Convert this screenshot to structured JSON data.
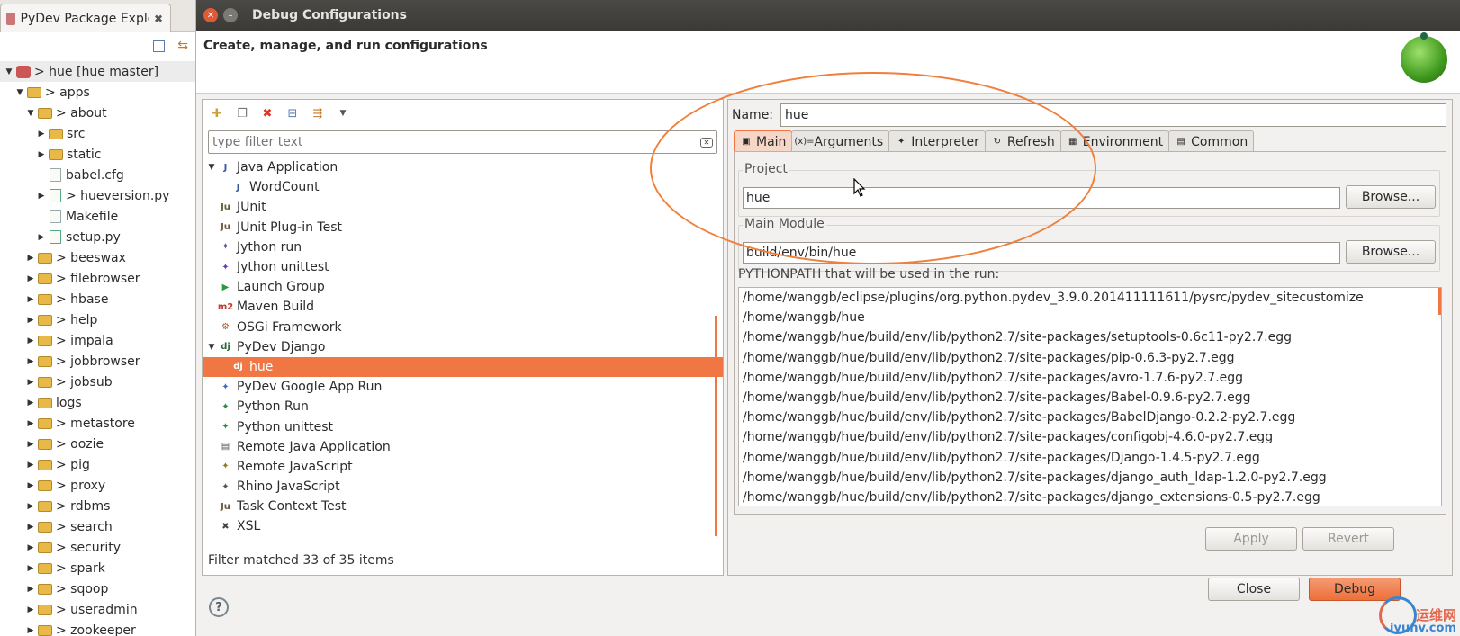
{
  "explorer": {
    "tab_title": "PyDev Package Explo",
    "close_glyph": "✖",
    "tree": [
      {
        "label": "> hue  [hue master]",
        "indent": 0,
        "kind": "project",
        "tri": "▼",
        "root": true
      },
      {
        "label": "> apps",
        "indent": 1,
        "kind": "folder",
        "tri": "▼"
      },
      {
        "label": "> about",
        "indent": 2,
        "kind": "folder",
        "tri": "▼"
      },
      {
        "label": "src",
        "indent": 3,
        "kind": "folder",
        "tri": "▶"
      },
      {
        "label": "static",
        "indent": 3,
        "kind": "folder",
        "tri": "▶"
      },
      {
        "label": "babel.cfg",
        "indent": 3,
        "kind": "file",
        "tri": ""
      },
      {
        "label": "> hueversion.py",
        "indent": 3,
        "kind": "py",
        "tri": "▶"
      },
      {
        "label": "Makefile",
        "indent": 3,
        "kind": "file",
        "tri": ""
      },
      {
        "label": "setup.py",
        "indent": 3,
        "kind": "py",
        "tri": "▶"
      },
      {
        "label": "> beeswax",
        "indent": 2,
        "kind": "folder",
        "tri": "▶"
      },
      {
        "label": "> filebrowser",
        "indent": 2,
        "kind": "folder",
        "tri": "▶"
      },
      {
        "label": "> hbase",
        "indent": 2,
        "kind": "folder",
        "tri": "▶"
      },
      {
        "label": "> help",
        "indent": 2,
        "kind": "folder",
        "tri": "▶"
      },
      {
        "label": "> impala",
        "indent": 2,
        "kind": "folder",
        "tri": "▶"
      },
      {
        "label": "> jobbrowser",
        "indent": 2,
        "kind": "folder",
        "tri": "▶"
      },
      {
        "label": "> jobsub",
        "indent": 2,
        "kind": "folder",
        "tri": "▶"
      },
      {
        "label": "logs",
        "indent": 2,
        "kind": "folder",
        "tri": "▶"
      },
      {
        "label": "> metastore",
        "indent": 2,
        "kind": "folder",
        "tri": "▶"
      },
      {
        "label": "> oozie",
        "indent": 2,
        "kind": "folder",
        "tri": "▶"
      },
      {
        "label": "> pig",
        "indent": 2,
        "kind": "folder",
        "tri": "▶"
      },
      {
        "label": "> proxy",
        "indent": 2,
        "kind": "folder",
        "tri": "▶"
      },
      {
        "label": "> rdbms",
        "indent": 2,
        "kind": "folder",
        "tri": "▶"
      },
      {
        "label": "> search",
        "indent": 2,
        "kind": "folder",
        "tri": "▶"
      },
      {
        "label": "> security",
        "indent": 2,
        "kind": "folder",
        "tri": "▶"
      },
      {
        "label": "> spark",
        "indent": 2,
        "kind": "folder",
        "tri": "▶"
      },
      {
        "label": "> sqoop",
        "indent": 2,
        "kind": "folder",
        "tri": "▶"
      },
      {
        "label": "> useradmin",
        "indent": 2,
        "kind": "folder",
        "tri": "▶"
      },
      {
        "label": "> zookeeper",
        "indent": 2,
        "kind": "folder",
        "tri": "▶"
      }
    ]
  },
  "dialog": {
    "title": "Debug Configurations",
    "header": "Create, manage, and run configurations",
    "filter_placeholder": "type filter text",
    "filter_status": "Filter matched 33 of 35 items",
    "configs": [
      {
        "label": "Java Application",
        "indent": 0,
        "tri": "▼",
        "icon": "J",
        "color": "#3b5998"
      },
      {
        "label": "WordCount",
        "indent": 1,
        "tri": "",
        "icon": "J",
        "color": "#3b5998"
      },
      {
        "label": "JUnit",
        "indent": 0,
        "tri": "",
        "icon": "Ju",
        "color": "#6a5a3a"
      },
      {
        "label": "JUnit Plug-in Test",
        "indent": 0,
        "tri": "",
        "icon": "Ju",
        "color": "#6a5a3a"
      },
      {
        "label": "Jython run",
        "indent": 0,
        "tri": "",
        "icon": "✦",
        "color": "#6a3ab8"
      },
      {
        "label": "Jython unittest",
        "indent": 0,
        "tri": "",
        "icon": "✦",
        "color": "#6a3ab8"
      },
      {
        "label": "Launch Group",
        "indent": 0,
        "tri": "",
        "icon": "▶",
        "color": "#2a9a3a"
      },
      {
        "label": "Maven Build",
        "indent": 0,
        "tri": "",
        "icon": "m2",
        "color": "#c0392b"
      },
      {
        "label": "OSGi Framework",
        "indent": 0,
        "tri": "",
        "icon": "⚙",
        "color": "#b05a20"
      },
      {
        "label": "PyDev Django",
        "indent": 0,
        "tri": "▼",
        "icon": "dj",
        "color": "#2a6a3a"
      },
      {
        "label": "hue",
        "indent": 1,
        "tri": "",
        "icon": "dj",
        "color": "#2a6a3a",
        "selected": true
      },
      {
        "label": "PyDev Google App Run",
        "indent": 0,
        "tri": "",
        "icon": "✦",
        "color": "#3a6ac8"
      },
      {
        "label": "Python Run",
        "indent": 0,
        "tri": "",
        "icon": "✦",
        "color": "#2a8a3a"
      },
      {
        "label": "Python unittest",
        "indent": 0,
        "tri": "",
        "icon": "✦",
        "color": "#2a8a3a"
      },
      {
        "label": "Remote Java Application",
        "indent": 0,
        "tri": "",
        "icon": "▤",
        "color": "#555"
      },
      {
        "label": "Remote JavaScript",
        "indent": 0,
        "tri": "",
        "icon": "✦",
        "color": "#8a7a2a"
      },
      {
        "label": "Rhino JavaScript",
        "indent": 0,
        "tri": "",
        "icon": "✦",
        "color": "#555"
      },
      {
        "label": "Task Context Test",
        "indent": 0,
        "tri": "",
        "icon": "Ju",
        "color": "#6a5a3a"
      },
      {
        "label": "XSL",
        "indent": 0,
        "tri": "",
        "icon": "✖",
        "color": "#444"
      }
    ],
    "name_label": "Name:",
    "name_value": "hue",
    "tabs": [
      {
        "label": "Main",
        "icon": "▣",
        "active": true
      },
      {
        "label": "Arguments",
        "icon": "(x)="
      },
      {
        "label": "Interpreter",
        "icon": "✦"
      },
      {
        "label": "Refresh",
        "icon": "↻"
      },
      {
        "label": "Environment",
        "icon": "▦"
      },
      {
        "label": "Common",
        "icon": "▤"
      }
    ],
    "project_label": "Project",
    "project_value": "hue",
    "browse_label": "Browse...",
    "module_label": "Main Module",
    "module_value": "build/env/bin/hue",
    "pythonpath_label": "PYTHONPATH that will be used in the run:",
    "pythonpath": [
      "/home/wanggb/eclipse/plugins/org.python.pydev_3.9.0.201411111611/pysrc/pydev_sitecustomize",
      "/home/wanggb/hue",
      "/home/wanggb/hue/build/env/lib/python2.7/site-packages/setuptools-0.6c11-py2.7.egg",
      "/home/wanggb/hue/build/env/lib/python2.7/site-packages/pip-0.6.3-py2.7.egg",
      "/home/wanggb/hue/build/env/lib/python2.7/site-packages/avro-1.7.6-py2.7.egg",
      "/home/wanggb/hue/build/env/lib/python2.7/site-packages/Babel-0.9.6-py2.7.egg",
      "/home/wanggb/hue/build/env/lib/python2.7/site-packages/BabelDjango-0.2.2-py2.7.egg",
      "/home/wanggb/hue/build/env/lib/python2.7/site-packages/configobj-4.6.0-py2.7.egg",
      "/home/wanggb/hue/build/env/lib/python2.7/site-packages/Django-1.4.5-py2.7.egg",
      "/home/wanggb/hue/build/env/lib/python2.7/site-packages/django_auth_ldap-1.2.0-py2.7.egg",
      "/home/wanggb/hue/build/env/lib/python2.7/site-packages/django_extensions-0.5-py2.7.egg"
    ],
    "apply_label": "Apply",
    "revert_label": "Revert",
    "close_label": "Close",
    "debug_label": "Debug",
    "help_glyph": "?"
  },
  "watermark": {
    "line1": "运维网",
    "line2": "iyunv.com"
  },
  "colors": {
    "accent": "#f07744",
    "annotation": "#f07f3c"
  }
}
